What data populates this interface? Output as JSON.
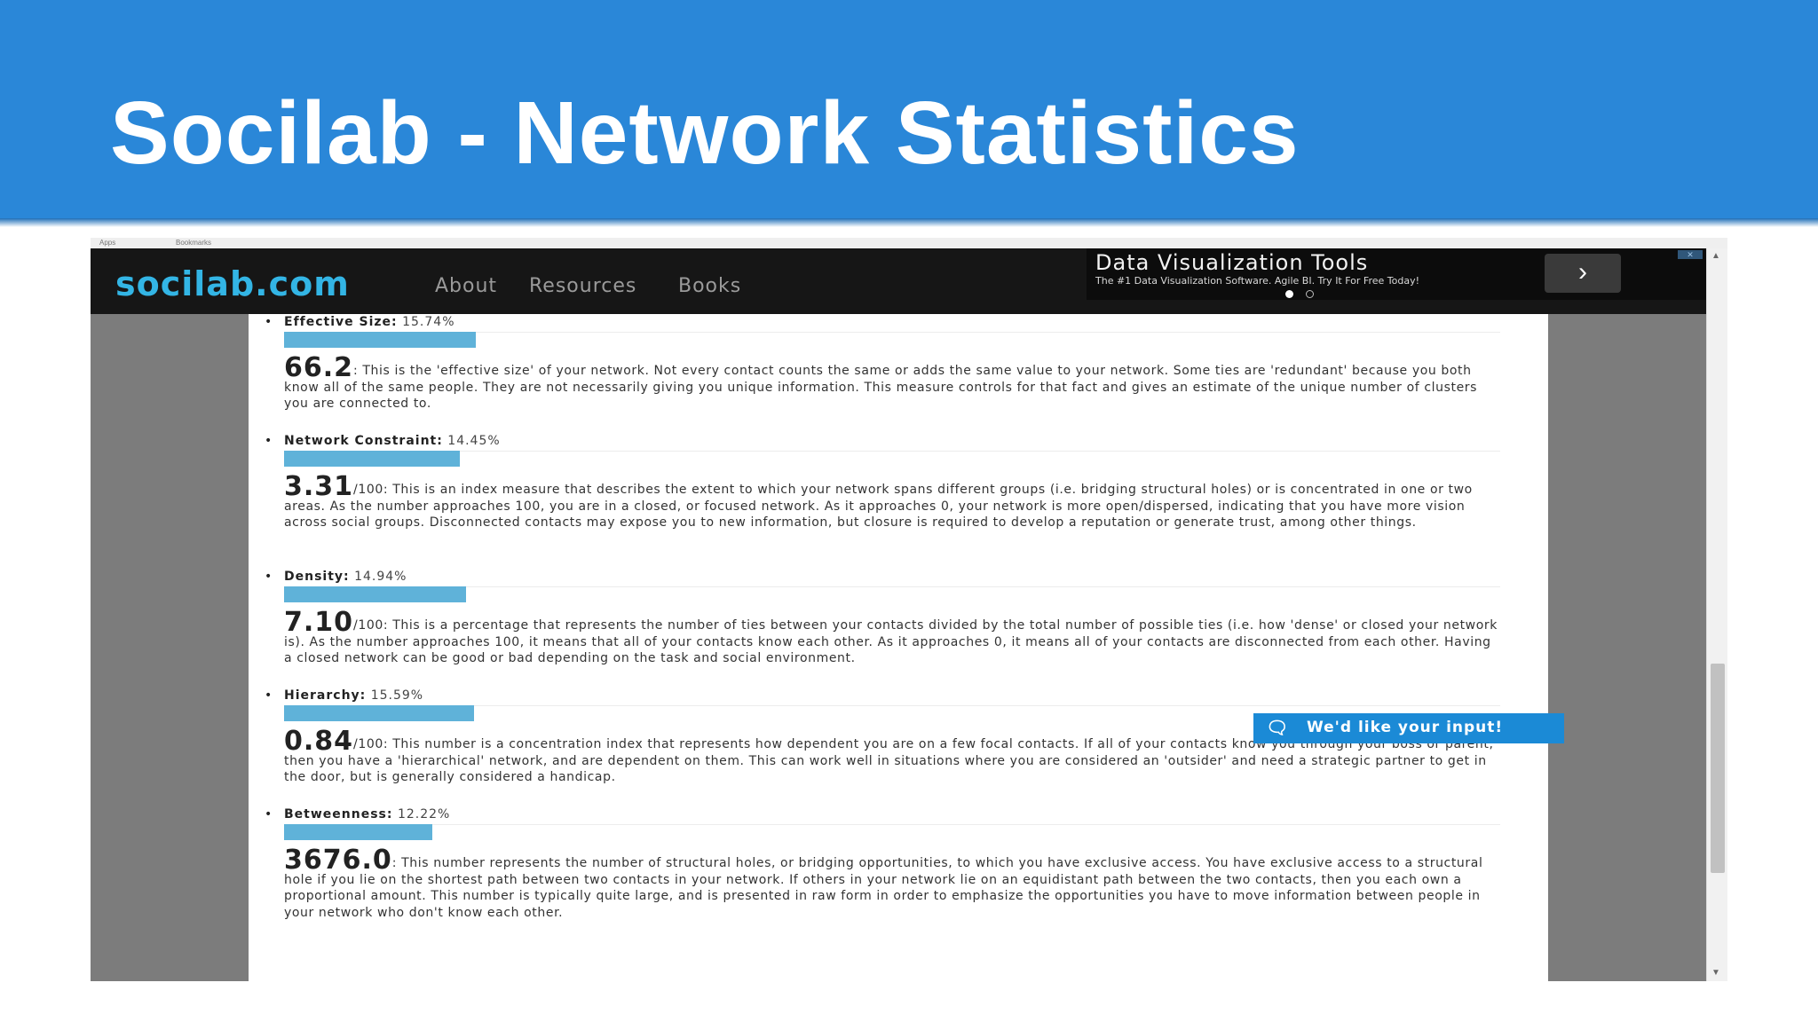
{
  "slide": {
    "title": "Socilab - Network Statistics"
  },
  "browser": {
    "bookmarks": [
      "Apps",
      "Bookmarks"
    ]
  },
  "site": {
    "logo": "socilab.com",
    "nav": [
      "About",
      "Resources",
      "Books"
    ]
  },
  "ad": {
    "title": "Data Visualization Tools",
    "subtitle": "The #1 Data Visualization Software. Agile BI. Try It For Free Today!",
    "next_icon": "chevron-right-icon"
  },
  "stats": [
    {
      "label": "Effective Size:",
      "percent": "15.74%",
      "fill": 0.1574,
      "value": "66.2",
      "unit": "",
      "description": ": This is the 'effective size' of your network. Not every contact counts the same or adds the same value to your network. Some ties are 'redundant' because you both know all of the same people. They are not necessarily giving you unique information. This measure controls for that fact and gives an estimate of the unique number of clusters you are connected to."
    },
    {
      "label": "Network Constraint:",
      "percent": "14.45%",
      "fill": 0.1445,
      "value": "3.31",
      "unit": "/100",
      "description": ": This is an index measure that describes the extent to which your network spans different groups (i.e. bridging structural holes) or is concentrated in one or two areas. As the number approaches 100, you are in a closed, or focused network. As it approaches 0, your network is more open/dispersed, indicating that you have more vision across social groups. Disconnected contacts may expose you to new information, but closure is required to develop a reputation or generate trust, among other things."
    },
    {
      "label": "Density:",
      "percent": "14.94%",
      "fill": 0.1494,
      "value": "7.10",
      "unit": "/100",
      "description": ": This is a percentage that represents the number of ties between your contacts divided by the total number of possible ties (i.e. how 'dense' or closed your network is). As the number approaches 100, it means that all of your contacts know each other. As it approaches 0, it means all of your contacts are disconnected from each other. Having a closed network can be good or bad depending on the task and social environment."
    },
    {
      "label": "Hierarchy:",
      "percent": "15.59%",
      "fill": 0.1559,
      "value": "0.84",
      "unit": "/100",
      "description": ": This number is a concentration index that represents how dependent you are on a few focal contacts. If all of your contacts know you through your boss or parent, then you have a 'hierarchical' network, and are dependent on them. This can work well in situations where you are considered an 'outsider' and need a strategic partner to get in the door, but is generally considered a handicap."
    },
    {
      "label": "Betweenness:",
      "percent": "12.22%",
      "fill": 0.1222,
      "value": "3676.0",
      "unit": "",
      "description": ": This number represents the number of structural holes, or bridging opportunities, to which you have exclusive access. You have exclusive access to a structural hole if you lie on the shortest path between two contacts in your network. If others in your network lie on an equidistant path between the two contacts, then you each own a proportional amount. This number is typically quite large, and is presented in raw form in order to emphasize the opportunities you have to move information between people in your network who don't know each other."
    }
  ],
  "feedback": {
    "label": "We'd like your input!",
    "icon": "chat-bubbles-icon"
  },
  "colors": {
    "header": "#2a87d8",
    "bar": "#5fb2d9",
    "logo": "#33b5e5",
    "feedback": "#1b8ad6"
  }
}
